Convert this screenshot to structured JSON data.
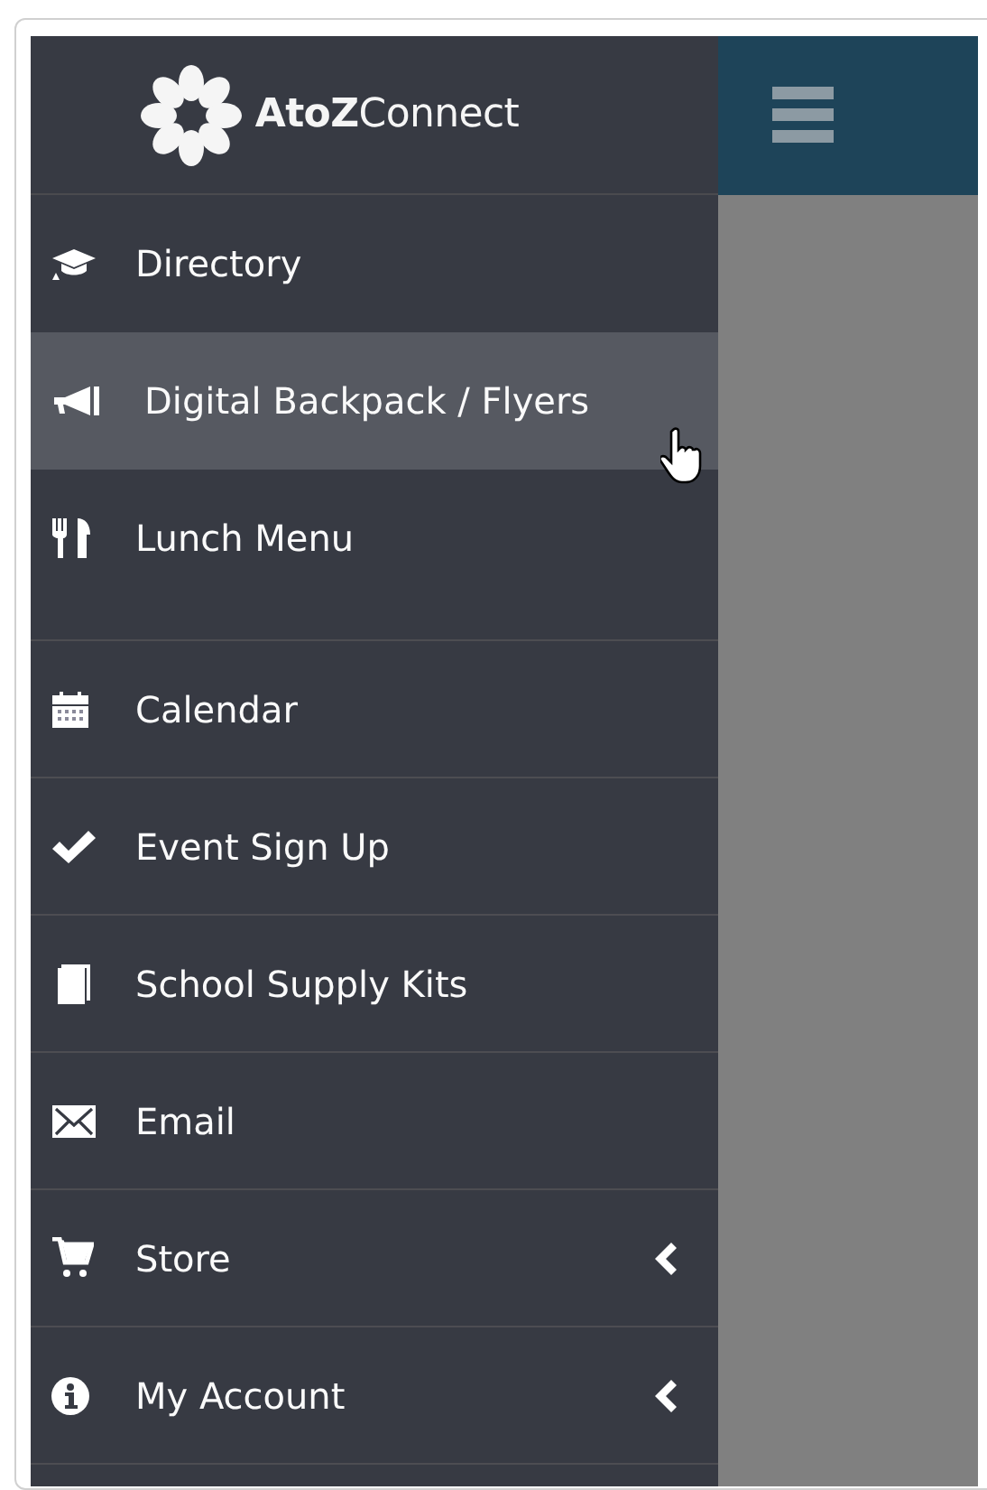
{
  "sidebar": {
    "logo": "**AtoZ**Connect",
    "items": [
      {
        "label": "Directory",
        "highlighted": false,
        "has_submenu": false,
        "kind": "normal"
      },
      {
        "label": "Digital Backpack / Flyers",
        "highlighted": true,
        "has_submenu": false,
        "kind": "normal"
      },
      {
        "label": "Lunch Menu",
        "highlighted": false,
        "has_submenu": false,
        "kind": "tall"
      },
      {
        "label": "Calendar",
        "highlighted": false,
        "has_submenu": false,
        "kind": "normal"
      },
      {
        "label": "Event Sign Up",
        "highlighted": false,
        "has_submenu": false,
        "kind": "normal"
      },
      {
        "label": "School Supply Kits",
        "highlighted": false,
        "has_submenu": false,
        "kind": "normal"
      },
      {
        "label": "Email",
        "highlighted": false,
        "has_submenu": false,
        "kind": "normal"
      },
      {
        "label": "Store",
        "highlighted": false,
        "has_submenu": true,
        "kind": "normal"
      },
      {
        "label": "My Account",
        "highlighted": false,
        "has_submenu": true,
        "kind": "normal"
      }
    ]
  }
}
